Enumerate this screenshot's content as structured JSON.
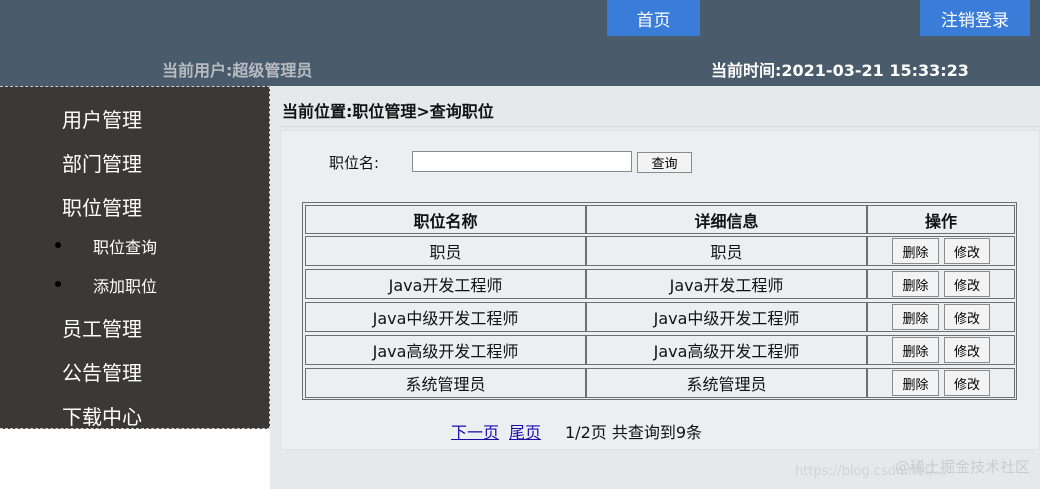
{
  "header": {
    "home_label": "首页",
    "logout_label": "注销登录",
    "current_user": "当前用户:超级管理员",
    "current_time": "当前时间:2021-03-21 15:33:23"
  },
  "sidebar": {
    "items": [
      {
        "label": "用户管理"
      },
      {
        "label": "部门管理"
      },
      {
        "label": "职位管理"
      },
      {
        "label": "职位查询"
      },
      {
        "label": "添加职位"
      },
      {
        "label": "员工管理"
      },
      {
        "label": "公告管理"
      },
      {
        "label": "下载中心"
      }
    ]
  },
  "main": {
    "breadcrumb": "当前位置:职位管理>查询职位",
    "search": {
      "label": "职位名:",
      "value": "",
      "placeholder": "",
      "button_label": "查询"
    },
    "table": {
      "headers": [
        "职位名称",
        "详细信息",
        "操作"
      ],
      "rows": [
        {
          "name": "职员",
          "detail": "职员"
        },
        {
          "name": "Java开发工程师",
          "detail": "Java开发工程师"
        },
        {
          "name": "Java中级开发工程师",
          "detail": "Java中级开发工程师"
        },
        {
          "name": "Java高级开发工程师",
          "detail": "Java高级开发工程师"
        },
        {
          "name": "系统管理员",
          "detail": "系统管理员"
        }
      ],
      "delete_label": "删除",
      "edit_label": "修改"
    },
    "pager": {
      "next_label": "下一页",
      "last_label": "尾页",
      "info": "1/2页 共查询到9条"
    }
  },
  "watermark": "@稀土掘金技术社区",
  "watermark_url": "https://blog.csdn.net/..."
}
